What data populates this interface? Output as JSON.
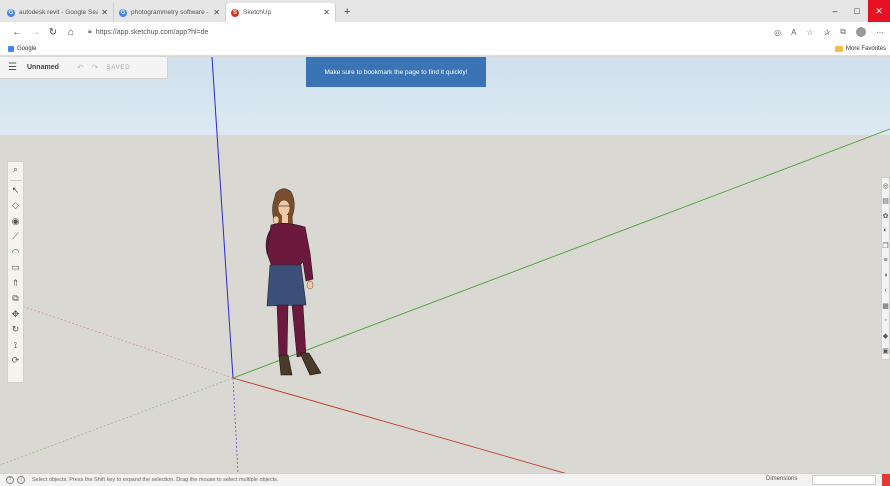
{
  "browser": {
    "tabs": [
      {
        "title": "autodesk revit - Google Search",
        "color": "#4285f4",
        "glyph": "G",
        "active": false
      },
      {
        "title": "photogrammetry software - Go",
        "color": "#4285f4",
        "glyph": "G",
        "active": false
      },
      {
        "title": "SketchUp",
        "color": "#d93025",
        "glyph": "S",
        "active": true
      }
    ],
    "new_tab": "+",
    "window": {
      "minimize": "–",
      "maximize": "□",
      "close": "✕"
    },
    "url": "https://app.sketchup.com/app?hl=de",
    "favorites": {
      "item": "Google",
      "more": "More Favorites"
    }
  },
  "sketchup": {
    "model_name": "Unnamed",
    "save_state": "SAVED",
    "banner": "Make sure to bookmark the page to find it quickly!",
    "left_tools": [
      "search-icon",
      "select-icon",
      "eraser-icon",
      "paint-bucket-icon",
      "line-icon",
      "arc-icon",
      "rectangle-icon",
      "push-pull-icon",
      "offset-icon",
      "move-icon",
      "rotate-icon",
      "tape-measure-icon",
      "orbit-icon"
    ],
    "left_glyphs": [
      "⌕",
      "↖",
      "◇",
      "◉",
      "⟋",
      "◠",
      "▭",
      "⇑",
      "⧉",
      "✥",
      "↻",
      "⟟",
      "⟳"
    ],
    "right_tools": [
      "entity-info-icon",
      "components-icon",
      "materials-icon",
      "styles-icon",
      "scenes-icon",
      "layers-icon",
      "shadows-icon",
      "outliner-icon",
      "views-icon",
      "instructor-icon",
      "3d-warehouse-icon",
      "display-icon",
      "export-icon"
    ],
    "right_glyphs": [
      "◎",
      "▤",
      "✿",
      "◐",
      "❐",
      "≡",
      "◑",
      "‹",
      "▦",
      "◦",
      "◆",
      "▣",
      "⊞"
    ],
    "status_message": "Select objects. Press the Shift key to expand the selection. Drag the mouse to select multiple objects.",
    "dimensions_label": "Dimensions",
    "axis_colors": {
      "red": "#c0392b",
      "green": "#3e9a2b",
      "blue": "#2a2ad0"
    }
  }
}
